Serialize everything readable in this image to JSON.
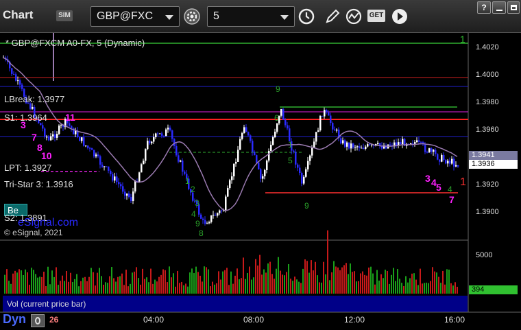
{
  "toolbar": {
    "app_title": "Chart",
    "sim_badge": "SIM",
    "symbol": "GBP@FXC",
    "interval": "5",
    "get_label": "GET"
  },
  "chart": {
    "symbol_header": "* GBP@FXCM A0-FX, 5 (Dynamic)",
    "copyright": "© eSignal, 2021",
    "watermark": "eSignal.com",
    "corner_badge": "Be",
    "levels": [
      {
        "label": "LBreak: 1.3977",
        "value": 1.3977,
        "color": "#d02020"
      },
      {
        "label": "S1: 1.3964",
        "value": 1.3964,
        "color": "#2020d0"
      },
      {
        "label": "LPT: 1.3927",
        "value": 1.3927,
        "color": "#e020e0"
      },
      {
        "label": "Tri-Star 3: 1.3916",
        "value": 1.3916,
        "color": "#ff2020"
      },
      {
        "label": "S2: 1.3891",
        "value": 1.3891,
        "color": "#2020d0"
      }
    ],
    "top_level": {
      "value": 1.4027,
      "marker": "1"
    },
    "right_marker": "1",
    "price_axis": [
      "1.4020",
      "1.4000",
      "1.3980",
      "1.3960",
      "1.3920",
      "1.3900"
    ],
    "price_tag_upper": "1.3941",
    "price_tag_last": "1.3936",
    "volume_panel_label": "Vol (current price bar)",
    "volume_axis": "5000",
    "volume_tag": "394",
    "time_axis": {
      "start": "26",
      "labels": [
        "04:00",
        "08:00",
        "12:00",
        "16:00"
      ]
    },
    "bottom_left": "Dyn",
    "td_labels_magenta": [
      "3",
      "7",
      "8",
      "10",
      "11",
      "3",
      "4",
      "5",
      "7"
    ],
    "td_labels_green": [
      "9",
      "9",
      "1",
      "2",
      "3",
      "4",
      "5",
      "6",
      "8",
      "4",
      "1",
      "9"
    ]
  },
  "colors": {
    "up_candle": "#ffffff",
    "down_candle": "#2a2aff",
    "ma_line": "#9a7ab0",
    "volume_up": "#1aa01a",
    "volume_down": "#c81a1a",
    "green_tag": "#30c030"
  }
}
